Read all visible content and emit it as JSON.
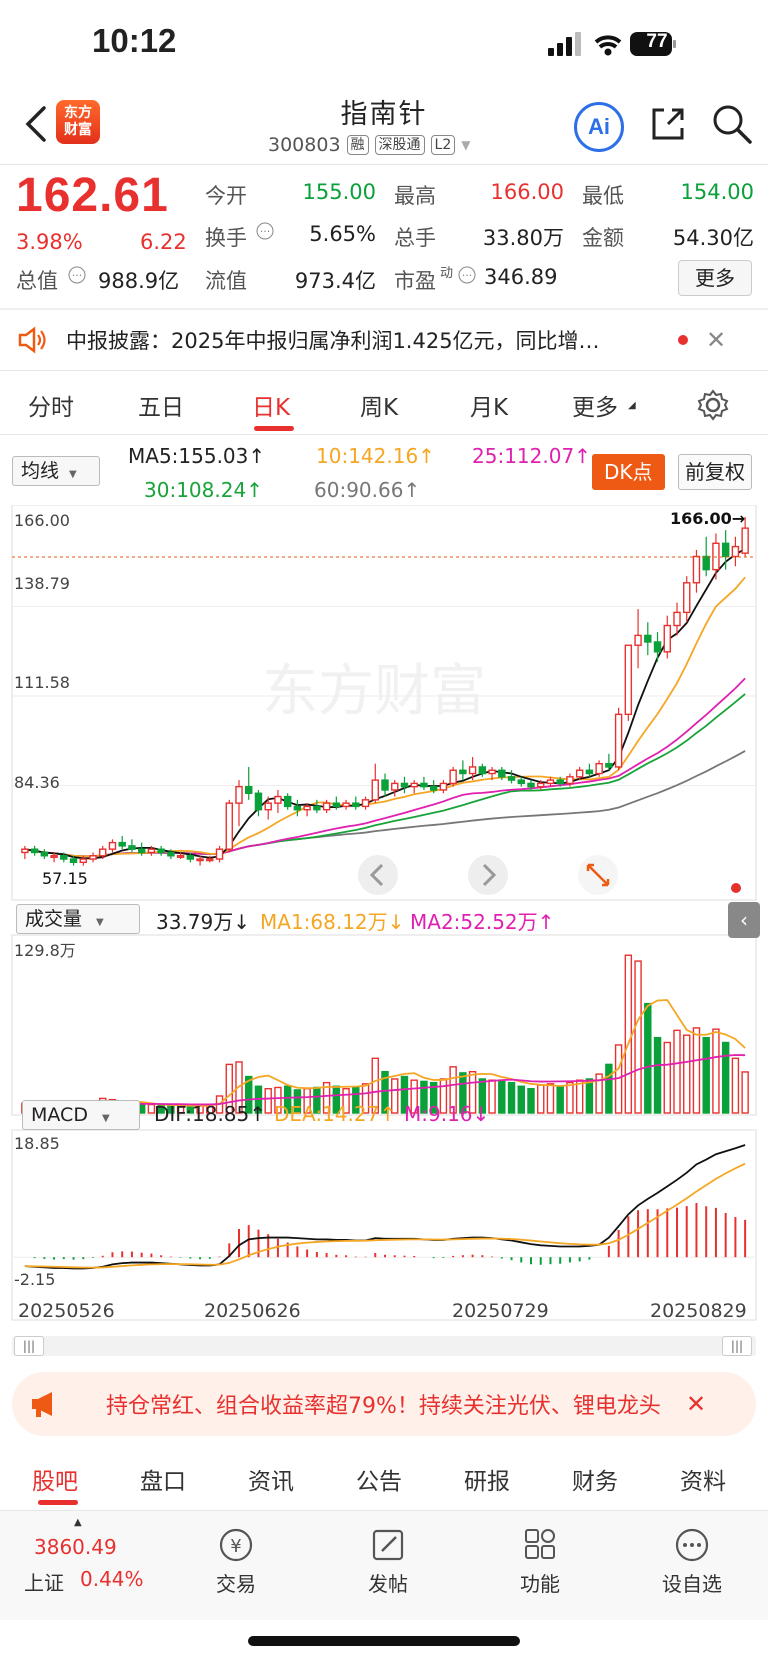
{
  "status": {
    "time": "10:12",
    "battery": "77"
  },
  "header": {
    "title": "指南针",
    "code": "300803",
    "tags": [
      "融",
      "深股通",
      "L2"
    ],
    "logo": "东方\n财富",
    "ai": "Ai"
  },
  "quote": {
    "price": "162.61",
    "pct": "3.98%",
    "chg": "6.22",
    "open_label": "今开",
    "open": "155.00",
    "high_label": "最高",
    "high": "166.00",
    "low_label": "最低",
    "low": "154.00",
    "turn_label": "换手",
    "turn": "5.65%",
    "vol_label": "总手",
    "vol": "33.80万",
    "amt_label": "金额",
    "amt": "54.30亿",
    "mcap_label": "总值",
    "mcap": "988.9亿",
    "float_label": "流值",
    "float": "973.4亿",
    "pe_label": "市盈",
    "pe_sup": "动",
    "pe": "346.89",
    "more": "更多"
  },
  "news": {
    "text": "中报披露：2025年中报归属净利润1.425亿元，同比增…"
  },
  "tabs": [
    "分时",
    "五日",
    "日K",
    "周K",
    "月K",
    "更多"
  ],
  "active_tab": "日K",
  "ma": {
    "select": "均线",
    "ma5": "MA5:155.03↑",
    "ma10": "10:142.16↑",
    "ma25": "25:112.07↑",
    "ma30": "30:108.24↑",
    "ma60": "60:90.66↑",
    "dk": "DK点",
    "fq": "前复权"
  },
  "kline": {
    "y_labels": [
      "166.00",
      "138.79",
      "111.58",
      "84.36"
    ],
    "high_mark": "166.00→",
    "low_mark": "57.15"
  },
  "volume": {
    "select": "成交量",
    "v": "33.79万↓",
    "ma1": "MA1:68.12万↓",
    "ma2": "MA2:52.52万↑",
    "max": "129.8万"
  },
  "macd": {
    "select": "MACD",
    "dif": "DIF:18.85↑",
    "dea": "DEA:14.27↑",
    "m": "M:9.16↓",
    "top": "18.85",
    "bottom": "-2.15"
  },
  "dates": [
    "20250526",
    "20250626",
    "20250729",
    "20250829"
  ],
  "banner": "持仓常红、组合收益率超79%！持续关注光伏、锂电龙头",
  "bottom_tabs": [
    "股吧",
    "盘口",
    "资讯",
    "公告",
    "研报",
    "财务",
    "资料"
  ],
  "nav": {
    "index_value": "3860.49",
    "index_name": "上证",
    "index_pct": "0.44%",
    "items": [
      "交易",
      "发帖",
      "功能",
      "设自选"
    ]
  },
  "colors": {
    "up": "#e8312f",
    "down": "#0aa03a",
    "accent": "#ee5a14",
    "ma5": "#111111",
    "ma10": "#f5a623",
    "ma25": "#e020b0",
    "ma30": "#19a33a",
    "ma60": "#777777"
  },
  "chart_data": {
    "type": "candlestick",
    "x_ticks": [
      "20250526",
      "20250626",
      "20250729",
      "20250829"
    ],
    "candles": [
      {
        "o": 64,
        "h": 66,
        "l": 62,
        "c": 65
      },
      {
        "o": 65,
        "h": 66,
        "l": 63,
        "c": 64
      },
      {
        "o": 64,
        "h": 65,
        "l": 62,
        "c": 63
      },
      {
        "o": 63,
        "h": 64,
        "l": 61,
        "c": 63
      },
      {
        "o": 63,
        "h": 64,
        "l": 61,
        "c": 62
      },
      {
        "o": 62,
        "h": 63,
        "l": 60,
        "c": 61
      },
      {
        "o": 61,
        "h": 63,
        "l": 60,
        "c": 62
      },
      {
        "o": 62,
        "h": 64,
        "l": 61,
        "c": 63
      },
      {
        "o": 63,
        "h": 66,
        "l": 62,
        "c": 65
      },
      {
        "o": 65,
        "h": 68,
        "l": 64,
        "c": 67
      },
      {
        "o": 67,
        "h": 69,
        "l": 65,
        "c": 66
      },
      {
        "o": 66,
        "h": 68,
        "l": 64,
        "c": 65
      },
      {
        "o": 65,
        "h": 67,
        "l": 63,
        "c": 64
      },
      {
        "o": 64,
        "h": 66,
        "l": 63,
        "c": 65
      },
      {
        "o": 65,
        "h": 66,
        "l": 63,
        "c": 64
      },
      {
        "o": 64,
        "h": 65,
        "l": 62,
        "c": 63
      },
      {
        "o": 63,
        "h": 64,
        "l": 62,
        "c": 63
      },
      {
        "o": 63,
        "h": 64,
        "l": 61,
        "c": 62
      },
      {
        "o": 62,
        "h": 63,
        "l": 60,
        "c": 62
      },
      {
        "o": 62,
        "h": 63,
        "l": 61,
        "c": 62
      },
      {
        "o": 62,
        "h": 66,
        "l": 61,
        "c": 65
      },
      {
        "o": 65,
        "h": 80,
        "l": 64,
        "c": 79
      },
      {
        "o": 79,
        "h": 86,
        "l": 72,
        "c": 84
      },
      {
        "o": 84,
        "h": 90,
        "l": 80,
        "c": 82
      },
      {
        "o": 82,
        "h": 83,
        "l": 75,
        "c": 77
      },
      {
        "o": 77,
        "h": 81,
        "l": 74,
        "c": 79
      },
      {
        "o": 79,
        "h": 83,
        "l": 76,
        "c": 81
      },
      {
        "o": 81,
        "h": 82,
        "l": 77,
        "c": 78
      },
      {
        "o": 78,
        "h": 80,
        "l": 75,
        "c": 77
      },
      {
        "o": 77,
        "h": 79,
        "l": 75,
        "c": 78
      },
      {
        "o": 78,
        "h": 80,
        "l": 76,
        "c": 77
      },
      {
        "o": 77,
        "h": 80,
        "l": 76,
        "c": 79
      },
      {
        "o": 79,
        "h": 81,
        "l": 77,
        "c": 78
      },
      {
        "o": 78,
        "h": 80,
        "l": 77,
        "c": 79
      },
      {
        "o": 79,
        "h": 81,
        "l": 77,
        "c": 78
      },
      {
        "o": 78,
        "h": 81,
        "l": 77,
        "c": 80
      },
      {
        "o": 80,
        "h": 91,
        "l": 79,
        "c": 86
      },
      {
        "o": 86,
        "h": 88,
        "l": 81,
        "c": 83
      },
      {
        "o": 83,
        "h": 86,
        "l": 81,
        "c": 85
      },
      {
        "o": 85,
        "h": 87,
        "l": 82,
        "c": 84
      },
      {
        "o": 84,
        "h": 86,
        "l": 82,
        "c": 85
      },
      {
        "o": 85,
        "h": 87,
        "l": 83,
        "c": 84
      },
      {
        "o": 84,
        "h": 86,
        "l": 82,
        "c": 83
      },
      {
        "o": 83,
        "h": 86,
        "l": 82,
        "c": 85
      },
      {
        "o": 85,
        "h": 90,
        "l": 84,
        "c": 89
      },
      {
        "o": 89,
        "h": 92,
        "l": 86,
        "c": 88
      },
      {
        "o": 88,
        "h": 93,
        "l": 86,
        "c": 90
      },
      {
        "o": 90,
        "h": 91,
        "l": 87,
        "c": 88
      },
      {
        "o": 88,
        "h": 90,
        "l": 86,
        "c": 89
      },
      {
        "o": 89,
        "h": 90,
        "l": 86,
        "c": 87
      },
      {
        "o": 87,
        "h": 89,
        "l": 85,
        "c": 86
      },
      {
        "o": 86,
        "h": 87,
        "l": 84,
        "c": 85
      },
      {
        "o": 85,
        "h": 86,
        "l": 83,
        "c": 84
      },
      {
        "o": 84,
        "h": 86,
        "l": 83,
        "c": 85
      },
      {
        "o": 85,
        "h": 87,
        "l": 84,
        "c": 86
      },
      {
        "o": 86,
        "h": 87,
        "l": 84,
        "c": 85
      },
      {
        "o": 85,
        "h": 88,
        "l": 84,
        "c": 87
      },
      {
        "o": 87,
        "h": 90,
        "l": 86,
        "c": 89
      },
      {
        "o": 89,
        "h": 91,
        "l": 87,
        "c": 88
      },
      {
        "o": 88,
        "h": 92,
        "l": 87,
        "c": 91
      },
      {
        "o": 91,
        "h": 94,
        "l": 89,
        "c": 90
      },
      {
        "o": 90,
        "h": 108,
        "l": 89,
        "c": 106
      },
      {
        "o": 106,
        "h": 127,
        "l": 104,
        "c": 127
      },
      {
        "o": 127,
        "h": 138,
        "l": 120,
        "c": 130
      },
      {
        "o": 130,
        "h": 134,
        "l": 124,
        "c": 128
      },
      {
        "o": 128,
        "h": 131,
        "l": 122,
        "c": 125
      },
      {
        "o": 125,
        "h": 136,
        "l": 123,
        "c": 133
      },
      {
        "o": 133,
        "h": 140,
        "l": 130,
        "c": 137
      },
      {
        "o": 137,
        "h": 148,
        "l": 134,
        "c": 146
      },
      {
        "o": 146,
        "h": 156,
        "l": 143,
        "c": 154
      },
      {
        "o": 154,
        "h": 160,
        "l": 148,
        "c": 150
      },
      {
        "o": 150,
        "h": 161,
        "l": 147,
        "c": 158
      },
      {
        "o": 158,
        "h": 162,
        "l": 150,
        "c": 154
      },
      {
        "o": 154,
        "h": 160,
        "l": 151,
        "c": 157
      },
      {
        "o": 155,
        "h": 166,
        "l": 154,
        "c": 162.61
      }
    ],
    "volume": [
      8,
      7,
      6,
      7,
      6,
      6,
      6,
      7,
      12,
      11,
      8,
      7,
      7,
      7,
      6,
      6,
      6,
      5,
      6,
      7,
      14,
      40,
      42,
      30,
      22,
      20,
      21,
      22,
      19,
      20,
      21,
      25,
      22,
      20,
      21,
      24,
      45,
      34,
      28,
      30,
      27,
      26,
      25,
      28,
      38,
      33,
      34,
      28,
      27,
      26,
      25,
      22,
      20,
      23,
      24,
      22,
      25,
      27,
      28,
      32,
      40,
      56,
      129.8,
      125,
      90,
      62,
      58,
      68,
      64,
      70,
      62,
      69,
      58,
      45,
      33.79
    ],
    "macd_dif": [
      -1.5,
      -1.6,
      -1.7,
      -1.8,
      -1.8,
      -1.9,
      -1.9,
      -1.8,
      -1.6,
      -1.2,
      -1.0,
      -0.9,
      -0.9,
      -0.9,
      -1.0,
      -1.1,
      -1.2,
      -1.3,
      -1.4,
      -1.4,
      -1.2,
      0.2,
      2.0,
      3.0,
      3.2,
      3.3,
      3.3,
      3.3,
      3.2,
      3.1,
      3.0,
      3.0,
      2.9,
      2.9,
      2.8,
      2.8,
      3.2,
      3.1,
      3.1,
      3.1,
      3.1,
      3.0,
      2.9,
      2.9,
      3.1,
      3.2,
      3.3,
      3.3,
      3.2,
      3.0,
      2.8,
      2.5,
      2.2,
      2.0,
      1.9,
      1.8,
      1.8,
      1.8,
      1.9,
      2.1,
      3.3,
      5.2,
      7.2,
      8.7,
      9.8,
      10.8,
      11.9,
      13.0,
      14.2,
      15.6,
      16.4,
      17.3,
      17.8,
      18.3,
      18.85
    ],
    "ylim": [
      57.15,
      166.0
    ]
  }
}
